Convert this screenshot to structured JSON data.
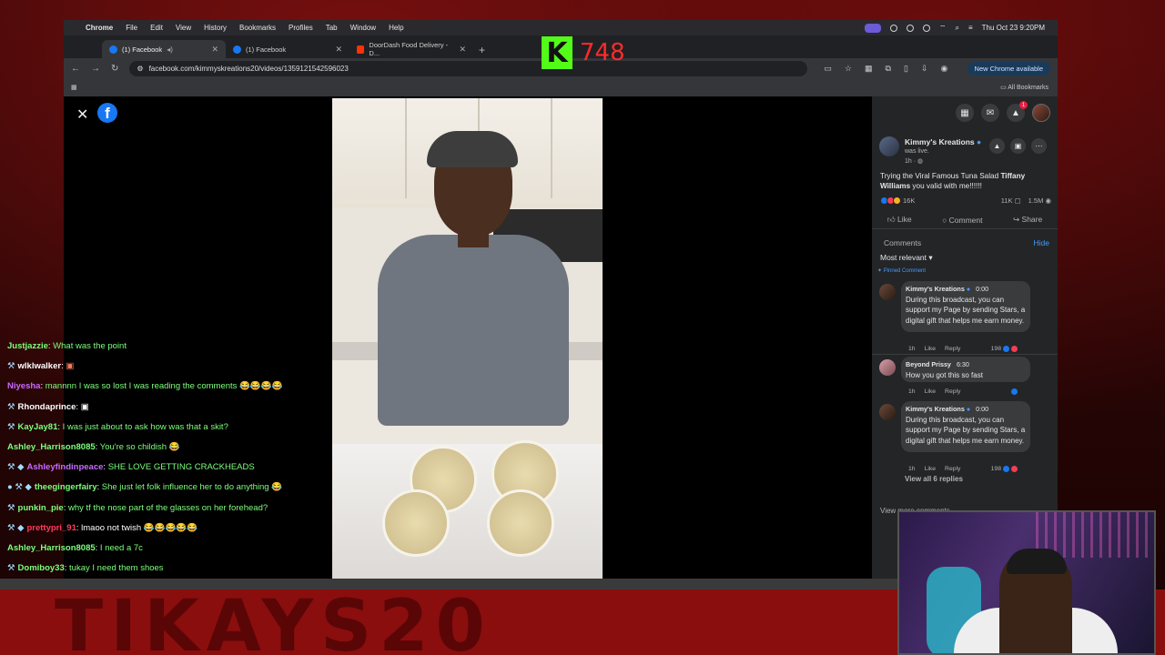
{
  "menubar": {
    "app": "Chrome",
    "items": [
      "File",
      "Edit",
      "View",
      "History",
      "Bookmarks",
      "Profiles",
      "Tab",
      "Window",
      "Help"
    ],
    "datetime": "Thu Oct 23  9:20PM"
  },
  "tabs": [
    {
      "label": "(1) Facebook",
      "favicon": "facebook-icon"
    },
    {
      "label": "(1) Facebook",
      "favicon": "facebook-icon"
    },
    {
      "label": "DoorDash Food Delivery - D...",
      "favicon": "doordash-icon"
    }
  ],
  "address": {
    "url": "facebook.com/kimmyskreations20/videos/1359121542596023",
    "update_label": "New Chrome available",
    "all_bookmarks": "All Bookmarks"
  },
  "kick": {
    "logo": "K",
    "viewers": "748",
    "accent": "#53fc18",
    "count_color": "#ff2a2a"
  },
  "chat": [
    {
      "user": "Justjazzie",
      "msg": "What was the point",
      "user_color": "#7cff7c",
      "msg_color": "#7cff7c",
      "prefix": ""
    },
    {
      "user": "wlklwalker",
      "msg": "▣",
      "user_color": "#ffffff",
      "msg_color": "#ff7a5a",
      "prefix": "⚒"
    },
    {
      "user": "Niyesha",
      "msg": "mannnn I was so lost I was reading the comments 😂😂😂😂",
      "user_color": "#c86bff",
      "msg_color": "#7cff7c",
      "prefix": ""
    },
    {
      "user": "Rhondaprince",
      "msg": "▣",
      "user_color": "#ffffff",
      "msg_color": "#ffffff",
      "prefix": "⚒"
    },
    {
      "user": "KayJay81",
      "msg": "I was just about to ask how was that a skit?",
      "user_color": "#7cff7c",
      "msg_color": "#7cff7c",
      "prefix": "⚒"
    },
    {
      "user": "Ashley_Harrison8085",
      "msg": "You're so childish 😂",
      "user_color": "#7cff7c",
      "msg_color": "#7cff7c",
      "prefix": ""
    },
    {
      "user": "Ashleyfindinpeace",
      "msg": "SHE LOVE GETTING CRACKHEADS",
      "user_color": "#c86bff",
      "msg_color": "#7cff7c",
      "prefix": "⚒ ◆"
    },
    {
      "user": "theegingerfairy",
      "msg": "She just let folk influence her to do anything 😂",
      "user_color": "#7cff7c",
      "msg_color": "#7cff7c",
      "prefix": "● ⚒ ◆"
    },
    {
      "user": "punkin_pie",
      "msg": "why tf the nose part of the glasses on her forehead?",
      "user_color": "#7cff7c",
      "msg_color": "#7cff7c",
      "prefix": "⚒"
    },
    {
      "user": "prettypri_91",
      "msg": "lmaoo not twish 😂😂😂😂😂",
      "user_color": "#ff3b5c",
      "msg_color": "#ffffff",
      "prefix": "⚒ ◆"
    },
    {
      "user": "Ashley_Harrison8085",
      "msg": "I need a 7c",
      "user_color": "#7cff7c",
      "msg_color": "#7cff7c",
      "prefix": ""
    },
    {
      "user": "Domiboy33",
      "msg": "tukay I need them shoes",
      "user_color": "#7cff7c",
      "msg_color": "#7cff7c",
      "prefix": "⚒"
    }
  ],
  "post": {
    "page_name": "Kimmy's Kreations",
    "status": "was live.",
    "time": "1h · ",
    "text_prefix": "Trying the Viral Famous Tuna Salad ",
    "tagged": "Tiffany Williams",
    "text_suffix": " you valid with me!!!!!!",
    "reaction_count": "16K",
    "comment_count": "11K",
    "view_count": "1.5M",
    "like": "Like",
    "comment": "Comment",
    "share": "Share"
  },
  "comments_section": {
    "title": "Comments",
    "hide": "Hide",
    "sort": "Most relevant",
    "pinned": "Pinned Comment",
    "items": [
      {
        "name": "Kimmy's Kreations",
        "time": "0:00",
        "text": "During this broadcast, you can support my Page by sending Stars, a digital gift that helps me earn money.",
        "age": "1h",
        "like": "Like",
        "reply": "Reply",
        "reactions": "198"
      },
      {
        "name": "Beyond Prissy",
        "time": "6:30",
        "text": "How you got this so fast",
        "age": "1h",
        "like": "Like",
        "reply": "Reply",
        "reactions": ""
      },
      {
        "name": "Kimmy's Kreations",
        "time": "0:00",
        "text": "During this broadcast, you can support my Page by sending Stars, a digital gift that helps me earn money.",
        "age": "1h",
        "like": "Like",
        "reply": "Reply",
        "reactions": "198"
      }
    ],
    "view_all": "View all 6 replies",
    "view_more": "View more comments"
  },
  "overlay": {
    "banner_text": "TIKAYS20"
  }
}
